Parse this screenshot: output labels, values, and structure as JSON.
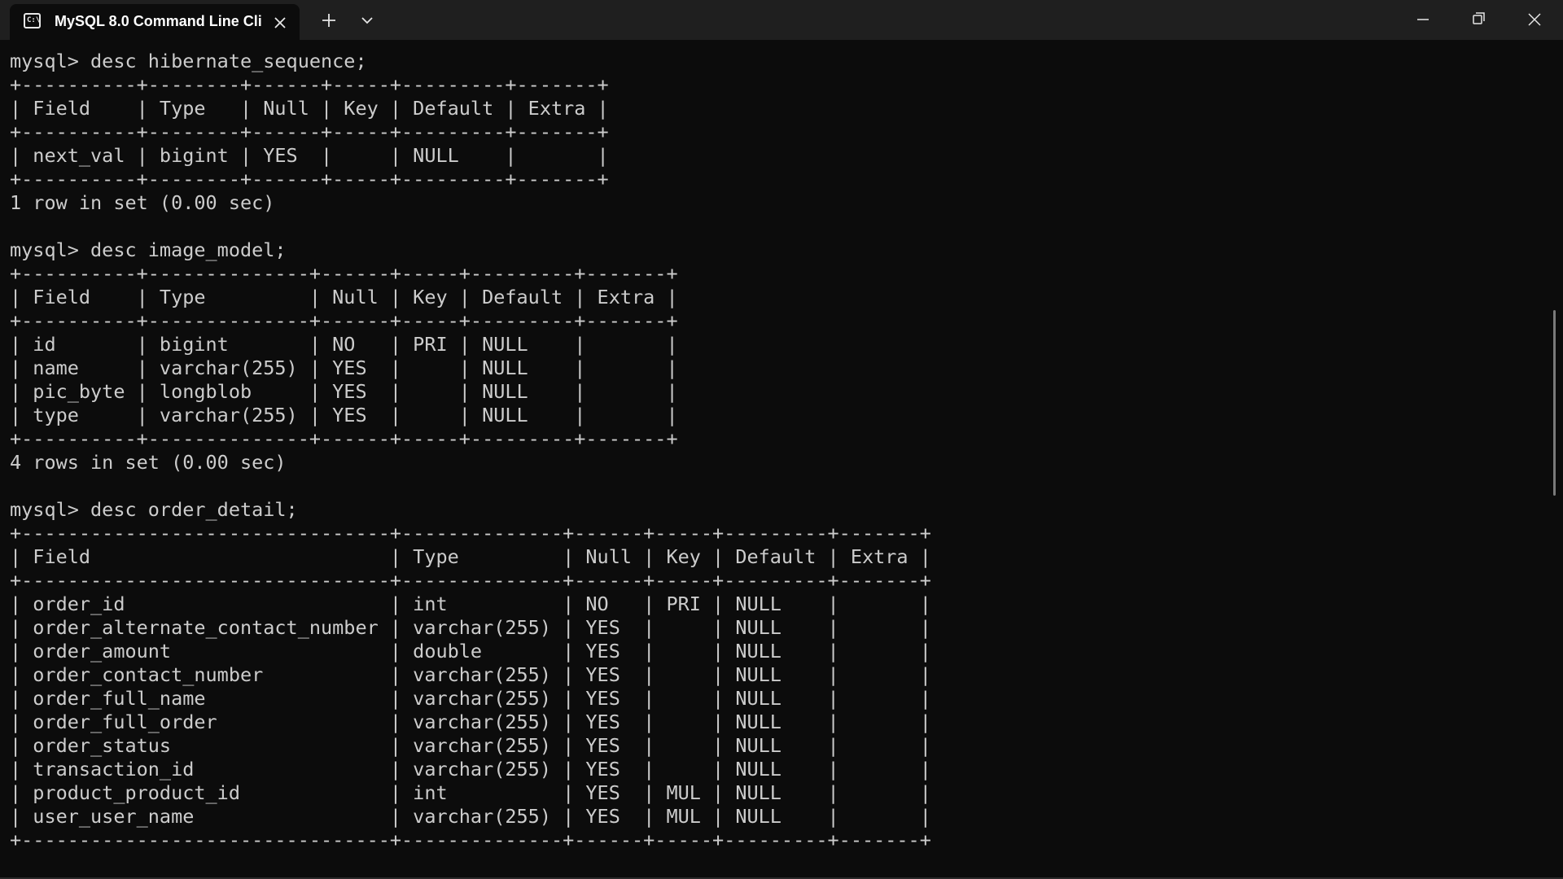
{
  "window": {
    "tab_title": "MySQL 8.0 Command Line Cli",
    "tab_icon_text": "C:\\"
  },
  "terminal": {
    "lines": [
      "mysql> desc hibernate_sequence;",
      "+----------+--------+------+-----+---------+-------+",
      "| Field    | Type   | Null | Key | Default | Extra |",
      "+----------+--------+------+-----+---------+-------+",
      "| next_val | bigint | YES  |     | NULL    |       |",
      "+----------+--------+------+-----+---------+-------+",
      "1 row in set (0.00 sec)",
      "",
      "mysql> desc image_model;",
      "+----------+--------------+------+-----+---------+-------+",
      "| Field    | Type         | Null | Key | Default | Extra |",
      "+----------+--------------+------+-----+---------+-------+",
      "| id       | bigint       | NO   | PRI | NULL    |       |",
      "| name     | varchar(255) | YES  |     | NULL    |       |",
      "| pic_byte | longblob     | YES  |     | NULL    |       |",
      "| type     | varchar(255) | YES  |     | NULL    |       |",
      "+----------+--------------+------+-----+---------+-------+",
      "4 rows in set (0.00 sec)",
      "",
      "mysql> desc order_detail;",
      "+--------------------------------+--------------+------+-----+---------+-------+",
      "| Field                          | Type         | Null | Key | Default | Extra |",
      "+--------------------------------+--------------+------+-----+---------+-------+",
      "| order_id                       | int          | NO   | PRI | NULL    |       |",
      "| order_alternate_contact_number | varchar(255) | YES  |     | NULL    |       |",
      "| order_amount                   | double       | YES  |     | NULL    |       |",
      "| order_contact_number           | varchar(255) | YES  |     | NULL    |       |",
      "| order_full_name                | varchar(255) | YES  |     | NULL    |       |",
      "| order_full_order               | varchar(255) | YES  |     | NULL    |       |",
      "| order_status                   | varchar(255) | YES  |     | NULL    |       |",
      "| transaction_id                 | varchar(255) | YES  |     | NULL    |       |",
      "| product_product_id             | int          | YES  | MUL | NULL    |       |",
      "| user_user_name                 | varchar(255) | YES  | MUL | NULL    |       |",
      "+--------------------------------+--------------+------+-----+---------+-------+"
    ]
  },
  "icons": {
    "tab_icon": "terminal-icon",
    "tab_close": "close-icon",
    "new_tab": "plus-icon",
    "tab_menu": "chevron-down-icon",
    "minimize": "minimize-icon",
    "maximize": "restore-icon",
    "close": "close-icon"
  },
  "colors": {
    "terminal_bg": "#0c0c0c",
    "terminal_fg": "#cccccc",
    "titlebar_bg": "#1f1f1f"
  }
}
